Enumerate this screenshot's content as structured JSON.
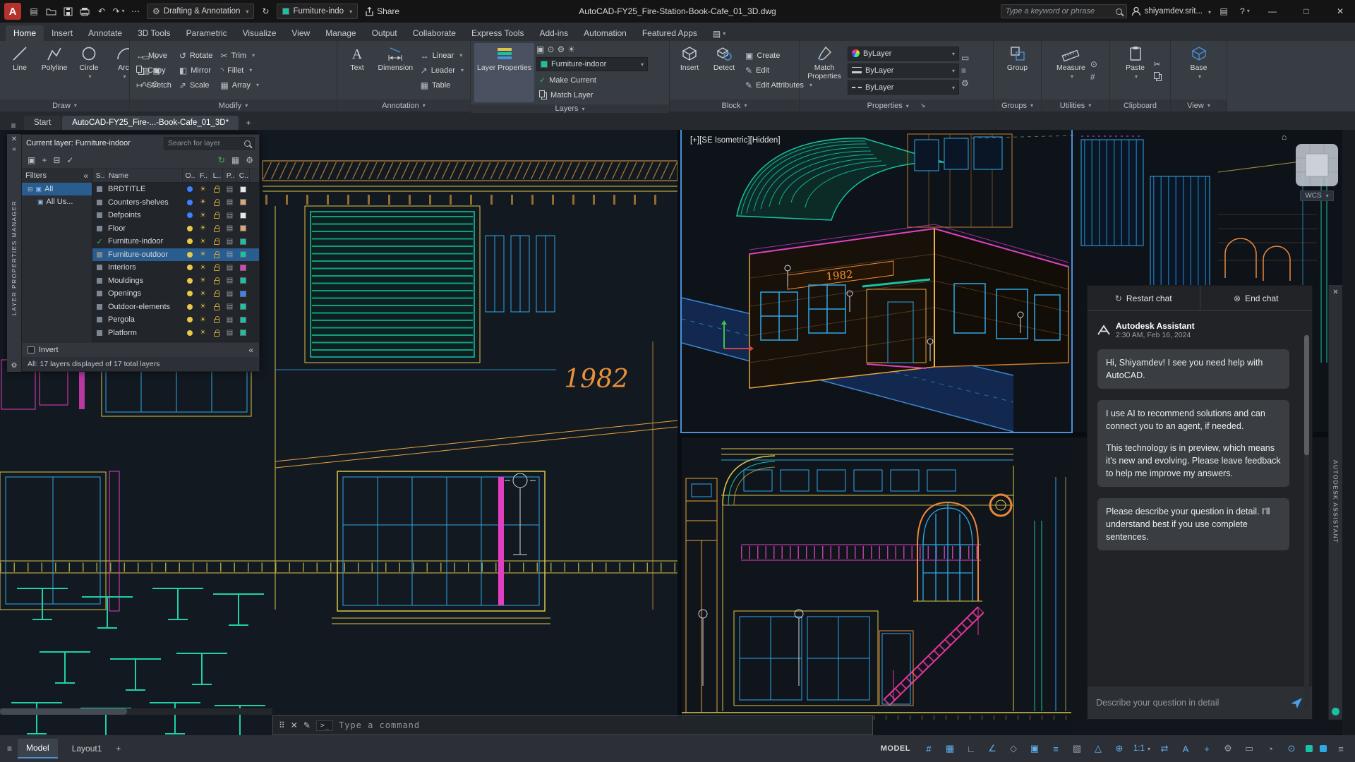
{
  "icons": {
    "hamburger": "≡",
    "close": "✕",
    "chevron": "▾",
    "gear": "⚙",
    "undo": "↶",
    "redo": "↷",
    "plus": "+",
    "menu_grid": "▤",
    "minimize": "—",
    "maximize": "□",
    "refresh": "↻",
    "end_chat": "⊗",
    "question": "?",
    "home": "⌂",
    "grid": "#",
    "more": "⋯",
    "prompt": ">_",
    "grip": "⠿",
    "pencil": "✎",
    "move": "↔",
    "rotate": "↺",
    "trim": "✂",
    "mirror": "◧",
    "fillet": "◝",
    "stretch": "↦",
    "scale_ic": "⇗",
    "array": "▦",
    "linear": "↔",
    "leader": "↗",
    "table": "▦",
    "create": "▣",
    "edit": "✎",
    "expand": "⊟",
    "filter_icon": "▣",
    "snap": "▦",
    "ortho": "∟",
    "polar": "∠",
    "isodraft": "◇",
    "osnap": "▣",
    "lineweight": "≡",
    "transparency": "▧",
    "dynucs": "△",
    "gizmo": "⊕",
    "switch": "⇄",
    "annotation_a": "A",
    "tray": "▭",
    "clock": "◔",
    "isolate": "⊙",
    "customize": "≡",
    "dialog_launcher": "↘",
    "collapse": "«",
    "sun": "☀",
    "printer": "▤",
    "check": "✓"
  },
  "colors": {
    "accent": "#4a90d9",
    "teal": "#17c3a4",
    "yellow": "#d8c84a",
    "orange": "#e8a33d",
    "magenta": "#e040c0",
    "cyan": "#2ea8e8",
    "blue": "#3f7fff",
    "canvas": "#131920"
  },
  "titlebar": {
    "workspace": "Drafting & Annotation",
    "quick_layer": "Furniture-indo",
    "share_label": "Share",
    "doc_title": "AutoCAD-FY25_Fire-Station-Book-Cafe_01_3D.dwg",
    "search_placeholder": "Type a keyword or phrase",
    "username": "shiyamdev.srit..."
  },
  "ribbon_tabs": [
    "Home",
    "Insert",
    "Annotate",
    "3D Tools",
    "Parametric",
    "Visualize",
    "View",
    "Manage",
    "Output",
    "Collaborate",
    "Express Tools",
    "Add-ins",
    "Automation",
    "Featured Apps"
  ],
  "ribbon": {
    "draw": {
      "label": "Draw",
      "line": "Line",
      "polyline": "Polyline",
      "circle": "Circle",
      "arc": "Arc"
    },
    "modify": {
      "label": "Modify",
      "move": "Move",
      "rotate": "Rotate",
      "trim": "Trim",
      "copy": "Copy",
      "mirror": "Mirror",
      "fillet": "Fillet",
      "stretch": "Stretch",
      "scale": "Scale",
      "array": "Array"
    },
    "annotation": {
      "label": "Annotation",
      "text": "Text",
      "dimension": "Dimension",
      "linear": "Linear",
      "leader": "Leader",
      "table": "Table"
    },
    "layers": {
      "label": "Layers",
      "layer_properties": "Layer Properties",
      "current": "Furniture-indoor",
      "make_current": "Make Current",
      "match_layer": "Match Layer"
    },
    "block": {
      "label": "Block",
      "insert": "Insert",
      "detect": "Detect",
      "create": "Create",
      "edit": "Edit",
      "edit_attributes": "Edit Attributes"
    },
    "properties": {
      "label": "Properties",
      "match_properties": "Match Properties",
      "color": "ByLayer",
      "lineweight": "ByLayer",
      "linetype": "ByLayer"
    },
    "groups": {
      "label": "Groups",
      "group": "Group"
    },
    "utilities": {
      "label": "Utilities",
      "measure": "Measure"
    },
    "clipboard": {
      "label": "Clipboard",
      "paste": "Paste"
    },
    "view": {
      "label": "View",
      "base": "Base"
    }
  },
  "file_tabs": {
    "start": "Start",
    "doc": "AutoCAD-FY25_Fire-...-Book-Cafe_01_3D*"
  },
  "palette": {
    "vertical_title": "LAYER PROPERTIES MANAGER",
    "current_label": "Current layer: Furniture-indoor",
    "search_placeholder": "Search for layer",
    "filters_label": "Filters",
    "tree_all": "All",
    "tree_used": "All Us...",
    "columns": [
      "S..",
      "Name",
      "O..",
      "F..",
      "L..",
      "P..",
      "C.."
    ],
    "layers": [
      {
        "name": "BRDTITLE",
        "color": "#e8e8e8",
        "bulb": "#3f7fff"
      },
      {
        "name": "Counters-shelves",
        "color": "#d8a878",
        "bulb": "#3f7fff"
      },
      {
        "name": "Defpoints",
        "color": "#e8e8e8",
        "bulb": "#3f7fff"
      },
      {
        "name": "Floor",
        "color": "#d8a878",
        "bulb": "#e8c84a"
      },
      {
        "name": "Furniture-indoor",
        "color": "#17c3a4",
        "bulb": "#e8c84a",
        "current": true
      },
      {
        "name": "Furniture-outdoor",
        "color": "#17c3a4",
        "bulb": "#e8c84a",
        "selected": true
      },
      {
        "name": "Interiors",
        "color": "#e040c0",
        "bulb": "#e8c84a"
      },
      {
        "name": "Mouldings",
        "color": "#17c3a4",
        "bulb": "#e8c84a"
      },
      {
        "name": "Openings",
        "color": "#3f7fff",
        "bulb": "#e8c84a"
      },
      {
        "name": "Outdoor-elements",
        "color": "#17c3a4",
        "bulb": "#e8c84a"
      },
      {
        "name": "Pergola",
        "color": "#17c3a4",
        "bulb": "#e8c84a"
      },
      {
        "name": "Platform",
        "color": "#17c3a4",
        "bulb": "#e8c84a"
      }
    ],
    "invert_label": "Invert",
    "status": "All: 17 layers displayed of 17 total layers"
  },
  "viewports": {
    "iso_label": "[+][SE Isometric][Hidden]",
    "wcs": "WCS",
    "sign_left": "1982",
    "sign_iso": "1982"
  },
  "command": {
    "placeholder": "Type a command"
  },
  "assistant": {
    "vertical_title": "AUTODESK ASSISTANT",
    "restart_label": "Restart chat",
    "end_label": "End chat",
    "name": "Autodesk Assistant",
    "timestamp": "2:30 AM, Feb 16, 2024",
    "msg1": "Hi, Shiyamdev! I see you need help with AutoCAD.",
    "msg2a": "I use AI to recommend solutions and can connect you to an agent, if needed.",
    "msg2b": "This technology is in preview, which means it's new and evolving. Please leave feedback to help me improve my answers.",
    "msg3": "Please describe your question in detail. I'll understand best if you use complete sentences.",
    "input_placeholder": "Describe your question in detail"
  },
  "statusbar": {
    "model": "Model",
    "layout": "Layout1",
    "mode": "MODEL",
    "scale": "1:1"
  }
}
